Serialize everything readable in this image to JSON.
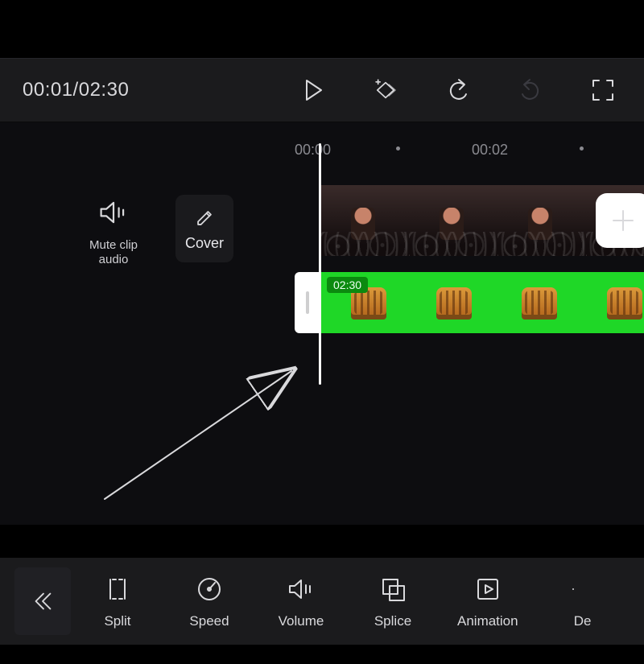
{
  "playback": {
    "current": "00:01",
    "total": "02:30",
    "time_display": "00:01/02:30"
  },
  "ruler": {
    "tick1": "00:00",
    "tick2": "00:02"
  },
  "left_controls": {
    "mute_label": "Mute clip audio",
    "cover_label": "Cover"
  },
  "overlay": {
    "duration_badge": "02:30"
  },
  "bottom_tools": {
    "split": "Split",
    "speed": "Speed",
    "volume": "Volume",
    "splice": "Splice",
    "animation": "Animation",
    "partial": "De"
  },
  "icons": {
    "play": "play-icon",
    "keyframe": "keyframe-add-icon",
    "undo": "undo-icon",
    "redo": "redo-icon",
    "fullscreen": "fullscreen-icon",
    "speaker": "speaker-icon",
    "pencil": "pencil-icon",
    "plus": "plus-icon",
    "back": "chevron-double-left-icon",
    "split": "split-icon",
    "speed_icon": "gauge-icon",
    "volume_icon": "speaker-waves-icon",
    "splice_icon": "overlap-squares-icon",
    "animation_icon": "play-box-icon"
  },
  "colors": {
    "green_track": "#1fd727",
    "arrow": "#ff0000"
  }
}
